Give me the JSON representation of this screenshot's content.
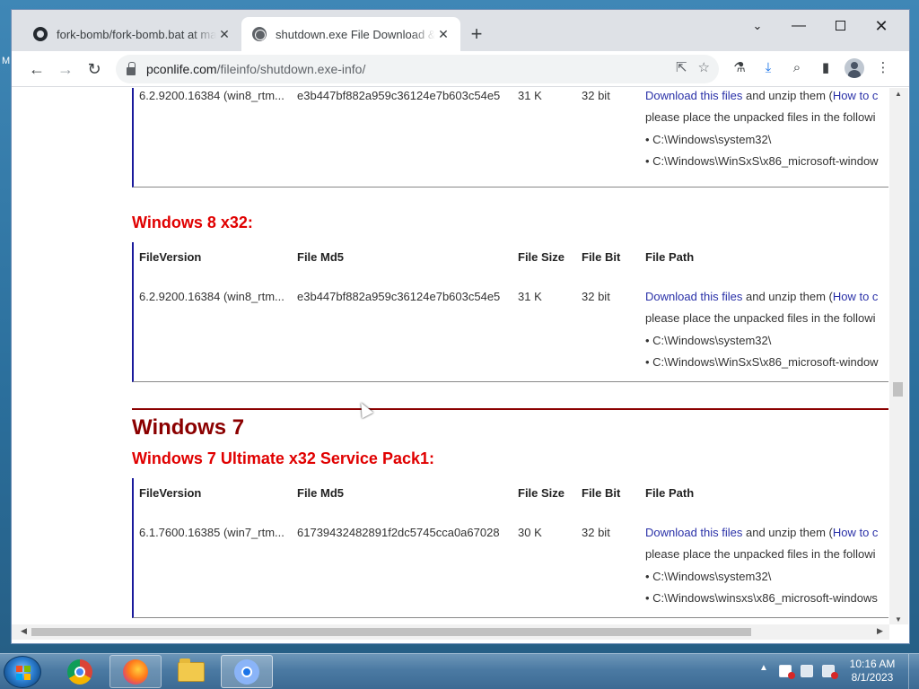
{
  "desktop": {
    "edge_text": "M"
  },
  "browser": {
    "tabs": [
      {
        "title": "fork-bomb/fork-bomb.bat at ma",
        "active": false
      },
      {
        "title": "shutdown.exe File Download & F",
        "active": true
      }
    ],
    "new_tab_icon": "+",
    "window_controls": {
      "tabsearch": "⌄",
      "minimize": "—",
      "close": "✕"
    },
    "url_host": "pconlife.com",
    "url_path": "/fileinfo/shutdown.exe-info/"
  },
  "page": {
    "columns": [
      "FileVersion",
      "File Md5",
      "File Size",
      "File Bit",
      "File Path"
    ],
    "path_lines": {
      "download_link": "Download this files",
      "unzip_text": " and unzip them (",
      "howto_link": "How to c",
      "place_text": "please place the unpacked files in the followi",
      "sys32": "• C:\\Windows\\system32\\"
    },
    "block_top": {
      "version": "6.2.9200.16384 (win8_rtm...",
      "md5": "e3b447bf882a959c36124e7b603c54e5",
      "size": "31 K",
      "bit": "32 bit",
      "winsxs": "• C:\\Windows\\WinSxS\\x86_microsoft-window"
    },
    "section_win8x32": {
      "heading": "Windows 8 x32:",
      "version": "6.2.9200.16384 (win8_rtm...",
      "md5": "e3b447bf882a959c36124e7b603c54e5",
      "size": "31 K",
      "bit": "32 bit",
      "winsxs": "• C:\\Windows\\WinSxS\\x86_microsoft-window"
    },
    "section_win7": {
      "os_heading": "Windows 7",
      "heading": "Windows 7 Ultimate x32 Service Pack1:",
      "version": "6.1.7600.16385 (win7_rtm...",
      "md5": "61739432482891f2dc5745cca0a67028",
      "size": "30 K",
      "bit": "32 bit",
      "winsxs": "• C:\\Windows\\winsxs\\x86_microsoft-windows"
    }
  },
  "taskbar": {
    "clock_time": "10:16 AM",
    "clock_date": "8/1/2023"
  },
  "colors": {
    "sub_heading": "#e00000",
    "os_heading": "#8b0000",
    "link": "#2a31a8"
  }
}
